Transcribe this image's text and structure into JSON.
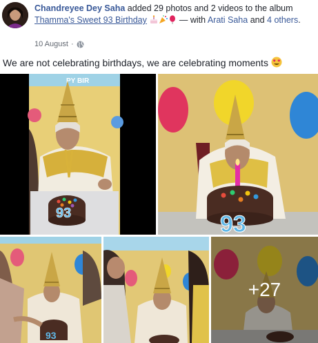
{
  "post": {
    "author": "Chandreyee Dey Saha",
    "action_text": " added 29 photos and 2 videos to the album ",
    "album_name": "Thamma's Sweet 93 Birthday",
    "with_text": " — with ",
    "tagged_person": "Arati Saha",
    "and_text": " and ",
    "others": "4 others",
    "end_text": ".",
    "date": "10 August",
    "separator": "·",
    "privacy_icon": "globe-icon",
    "caption": "We are not celebrating birthdays, we are celebrating moments",
    "caption_emoji": "heart-eyes-emoji",
    "album_emojis": [
      "cake-emoji",
      "party-popper-emoji",
      "balloon-emoji"
    ]
  },
  "gallery": {
    "more_count": "+27",
    "cake_number": "93",
    "banner_text": "PY BIR"
  },
  "colors": {
    "link": "#385898",
    "text": "#1d2129",
    "meta": "#616770",
    "wall_yellow": "#e8cf77",
    "hat_gold": "#c9a646",
    "cake_brown": "#4a2c22",
    "number_blue": "#5fb8e8"
  }
}
